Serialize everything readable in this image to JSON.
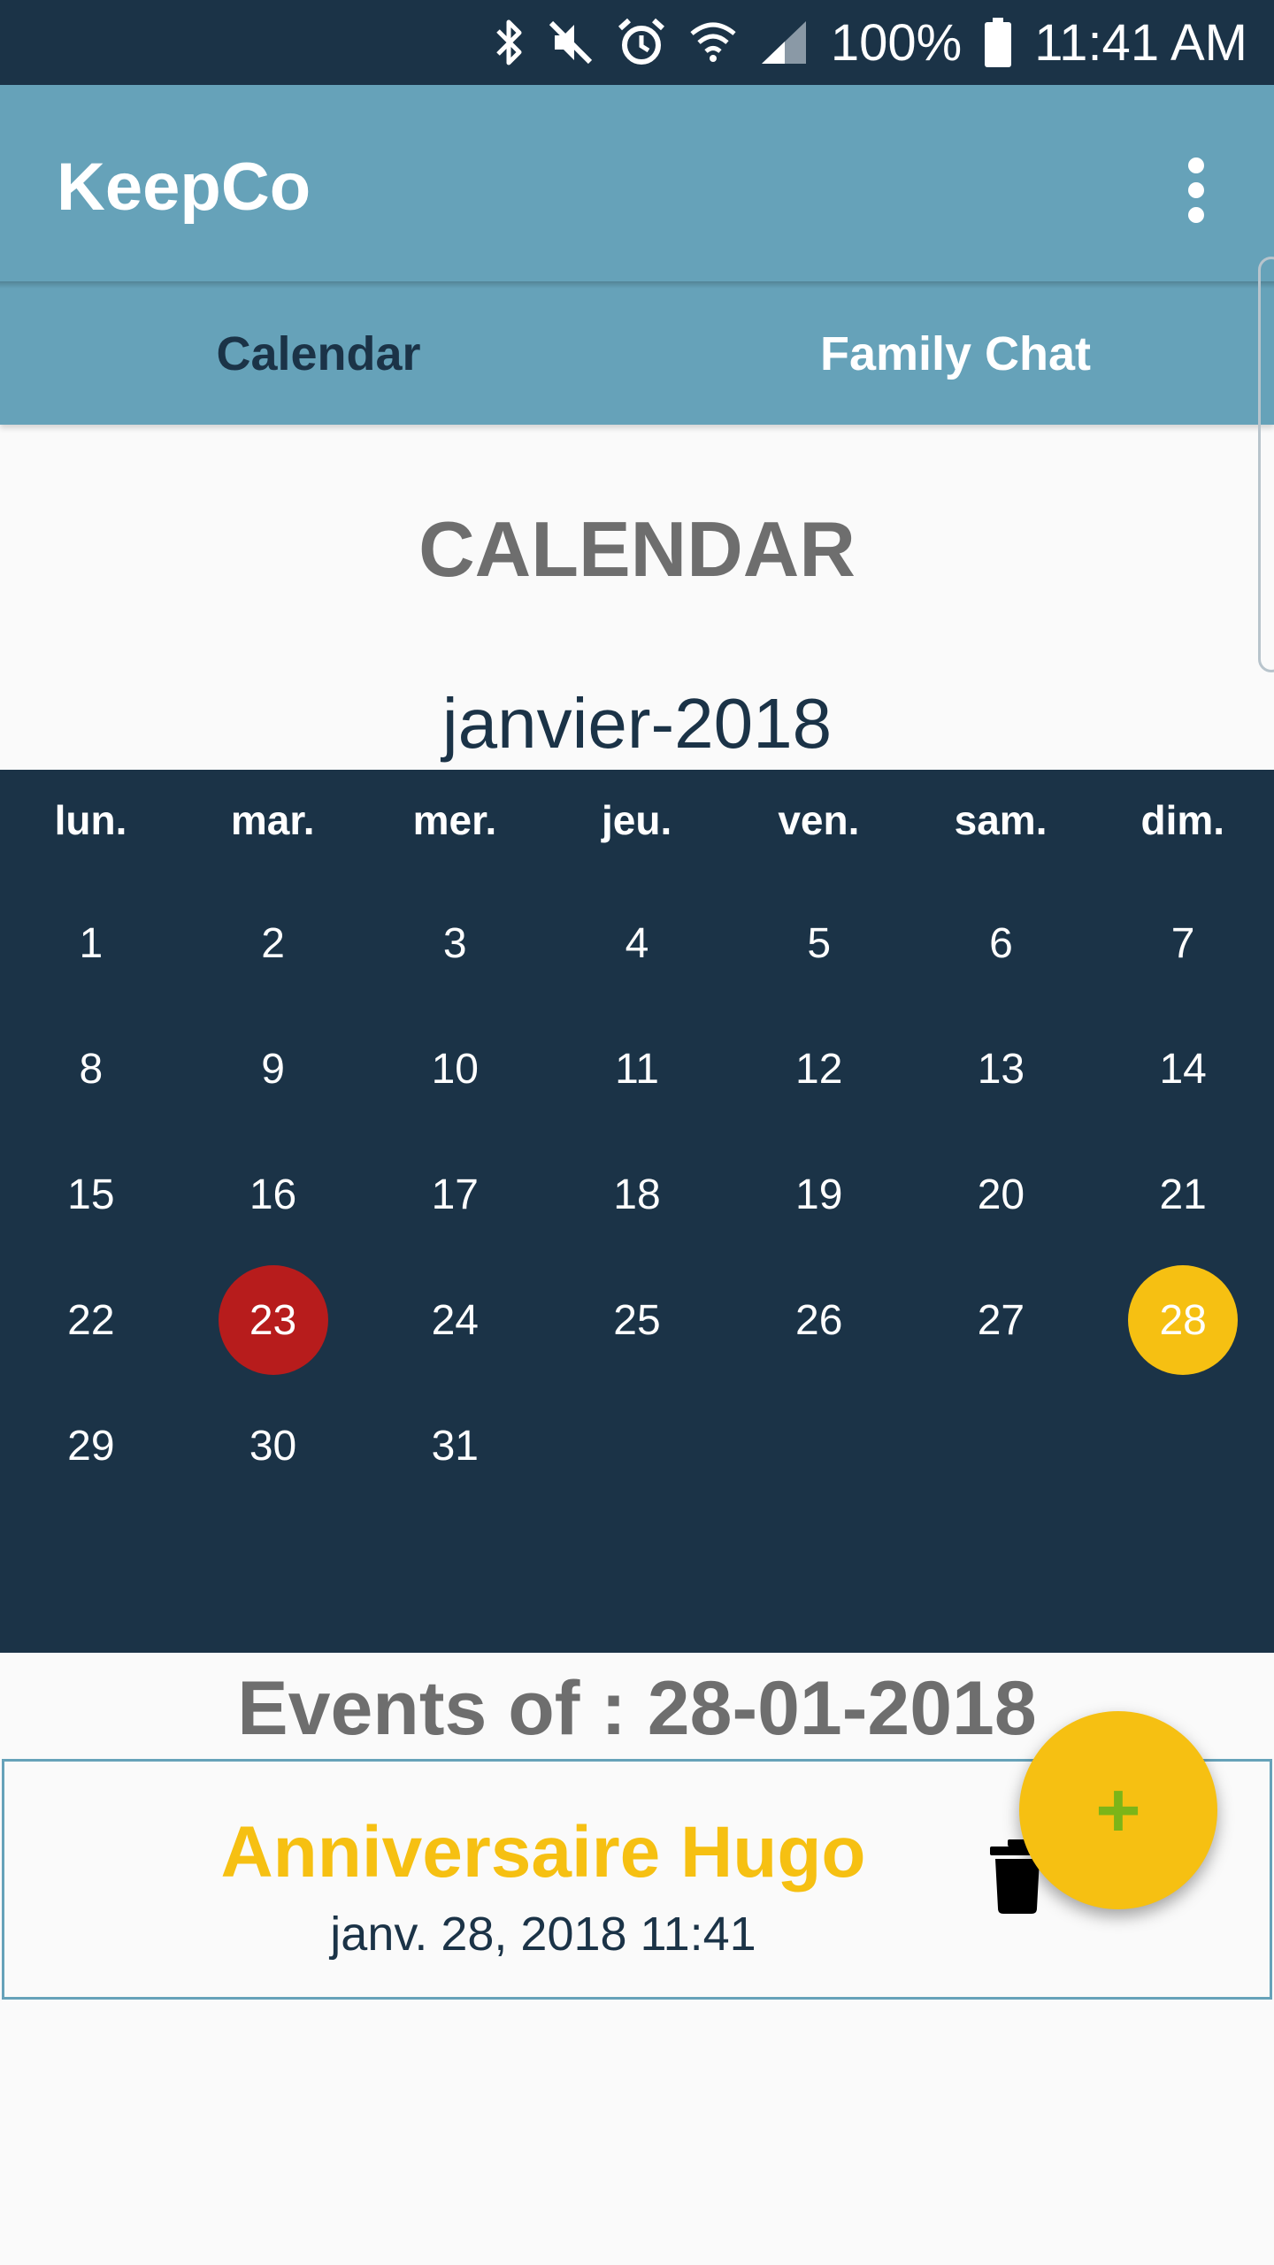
{
  "status_bar": {
    "battery": "100%",
    "time": "11:41 AM",
    "icons": [
      "bluetooth-icon",
      "mute-icon",
      "alarm-icon",
      "wifi-icon",
      "signal-icon",
      "battery-icon"
    ]
  },
  "app_bar": {
    "title": "KeepCo",
    "menu_icon": "more-vert-icon"
  },
  "tabs": [
    {
      "label": "Calendar",
      "active": true
    },
    {
      "label": "Family Chat",
      "active": false
    }
  ],
  "page_heading": "CALENDAR",
  "calendar": {
    "month_label": "janvier-2018",
    "weekdays": [
      "lun.",
      "mar.",
      "mer.",
      "jeu.",
      "ven.",
      "sam.",
      "dim."
    ],
    "first_weekday_index": 0,
    "days_in_month": 31,
    "today": 23,
    "selected": 28
  },
  "events_heading": "Events of : 28-01-2018",
  "events": [
    {
      "title": "Anniversaire Hugo",
      "datetime": "janv. 28, 2018 11:41"
    }
  ],
  "fab_label": "+",
  "colors": {
    "primary": "#66a2b9",
    "dark": "#1b3347",
    "accent": "#f6c012",
    "today": "#b71c1c",
    "fab_icon": "#7cb518"
  }
}
